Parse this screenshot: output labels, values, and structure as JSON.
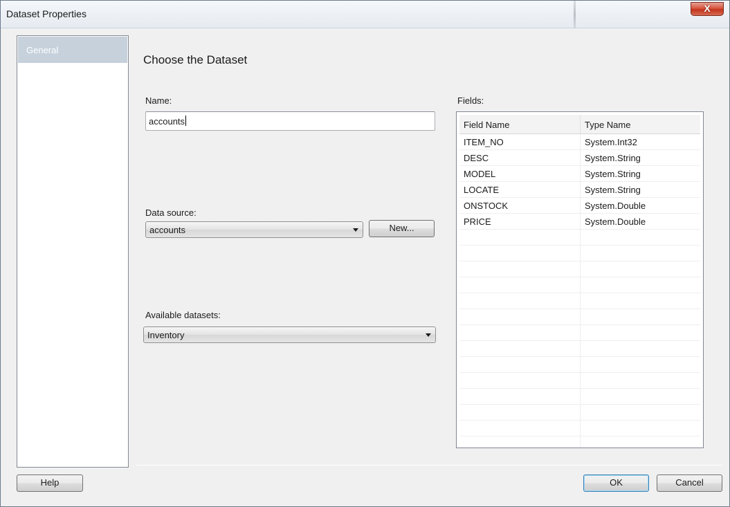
{
  "window": {
    "title": "Dataset Properties",
    "close_glyph": "X"
  },
  "nav": {
    "items": [
      {
        "label": "General",
        "selected": true
      }
    ]
  },
  "page": {
    "heading": "Choose the Dataset"
  },
  "name_field": {
    "label": "Name:",
    "value": "accounts"
  },
  "data_source": {
    "label": "Data source:",
    "selected": "accounts",
    "new_button": "New..."
  },
  "available_datasets": {
    "label": "Available datasets:",
    "selected": "Inventory"
  },
  "fields": {
    "label": "Fields:",
    "columns": [
      "Field Name",
      "Type Name"
    ],
    "rows": [
      [
        "ITEM_NO",
        "System.Int32"
      ],
      [
        "DESC",
        "System.String"
      ],
      [
        "MODEL",
        "System.String"
      ],
      [
        "LOCATE",
        "System.String"
      ],
      [
        "ONSTOCK",
        "System.Double"
      ],
      [
        "PRICE",
        "System.Double"
      ],
      [
        "",
        ""
      ],
      [
        "",
        ""
      ],
      [
        "",
        ""
      ],
      [
        "",
        ""
      ],
      [
        "",
        ""
      ],
      [
        "",
        ""
      ],
      [
        "",
        ""
      ],
      [
        "",
        ""
      ],
      [
        "",
        ""
      ],
      [
        "",
        ""
      ],
      [
        "",
        ""
      ],
      [
        "",
        ""
      ],
      [
        "",
        ""
      ],
      [
        "",
        ""
      ]
    ]
  },
  "footer": {
    "help": "Help",
    "ok": "OK",
    "cancel": "Cancel"
  },
  "colors": {
    "nav_selected": "#c6d1dc",
    "close_button": "#c4351e",
    "default_button_border": "#3c7fb1"
  }
}
